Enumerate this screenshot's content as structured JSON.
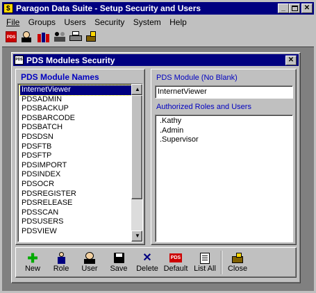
{
  "app": {
    "title": "Paragon Data Suite - Setup Security and Users"
  },
  "menu": [
    "File",
    "Groups",
    "Users",
    "Security",
    "System",
    "Help"
  ],
  "toolbar_icons": [
    "pds-icon",
    "user-icon",
    "group-icon",
    "roles-icon",
    "printer-icon",
    "exit-icon"
  ],
  "dialog": {
    "title": "PDS Modules Security",
    "left_header": "PDS Module Names",
    "modules": [
      "InternetViewer",
      "PDSADMIN",
      "PDSBACKUP",
      "PDSBARCODE",
      "PDSBATCH",
      "PDSDSN",
      "PDSFTB",
      "PDSFTP",
      "PDSIMPORT",
      "PDSINDEX",
      "PDSOCR",
      "PDSREGISTER",
      "PDSRELEASE",
      "PDSSCAN",
      "PDSUSERS",
      "PDSVIEW"
    ],
    "selected_module": "InternetViewer",
    "module_label": "PDS Module (No Blank)",
    "module_value": "InternetViewer",
    "roles_label": "Authorized Roles and Users",
    "roles": [
      ".Kathy",
      ".Admin",
      ".Supervisor"
    ]
  },
  "buttons": {
    "new": "New",
    "role": "Role",
    "user": "User",
    "save": "Save",
    "delete": "Delete",
    "default": "Default",
    "listall": "List All",
    "close": "Close"
  },
  "colors": {
    "title_bg": "#000080",
    "face": "#c0c0c0",
    "header_text": "#0000c0"
  }
}
